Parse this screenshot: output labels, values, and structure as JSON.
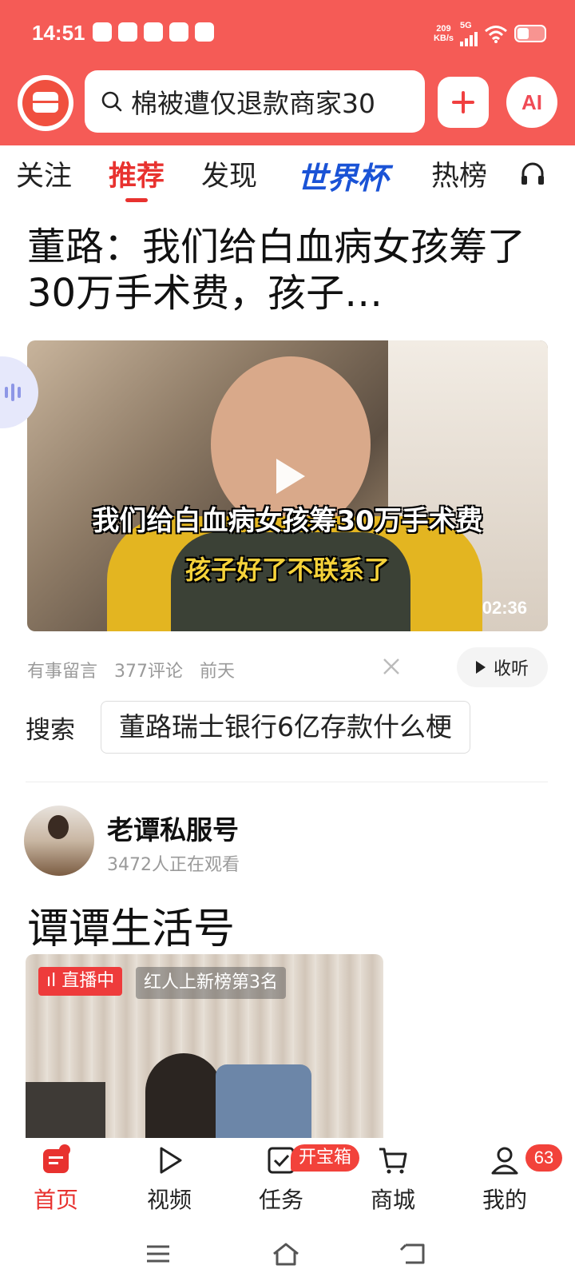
{
  "status": {
    "time": "14:51",
    "net_speed_value": "209",
    "net_speed_unit": "KB/s",
    "network": "5G",
    "apps": [
      "app-icon",
      "app-icon",
      "toutiao-app-icon",
      "app-icon",
      "taobao-app-icon"
    ]
  },
  "header": {
    "search_query": "棉被遭仅退款商家30",
    "ai_label": "AI"
  },
  "tabs": [
    {
      "label": "关注",
      "active": false
    },
    {
      "label": "推荐",
      "active": true
    },
    {
      "label": "发现",
      "active": false
    },
    {
      "label": "世界杯",
      "active": false
    },
    {
      "label": "热榜",
      "active": false
    }
  ],
  "article": {
    "headline": "董路：我们给白血病女孩筹了30万手术费，孩子…",
    "video_caption_1": "我们给白血病女孩筹30万手术费",
    "video_caption_2": "孩子好了不联系了",
    "duration": "02:36",
    "source": "有事留言",
    "comments": "377评论",
    "time": "前天",
    "listen_label": "收听"
  },
  "search_suggest": {
    "label": "搜索",
    "query": "董路瑞士银行6亿存款什么梗"
  },
  "live_card": {
    "author": "老谭私服号",
    "viewers": "3472人正在观看",
    "title": "谭谭生活号",
    "live_badge": "直播中",
    "rank_tag": "红人上新榜第3名"
  },
  "bottom_nav": [
    {
      "label": "首页",
      "icon": "home-icon",
      "active": true
    },
    {
      "label": "视频",
      "icon": "play-icon",
      "active": false
    },
    {
      "label": "任务",
      "icon": "task-icon",
      "active": false
    },
    {
      "label": "商城",
      "icon": "cart-icon",
      "active": false
    },
    {
      "label": "我的",
      "icon": "user-icon",
      "active": false
    }
  ],
  "badges": {
    "treasure": "开宝箱",
    "profile_count": "63"
  },
  "colors": {
    "brand_red": "#f55b56",
    "active_red": "#e8322f",
    "worldcup_blue": "#1a53d6"
  }
}
